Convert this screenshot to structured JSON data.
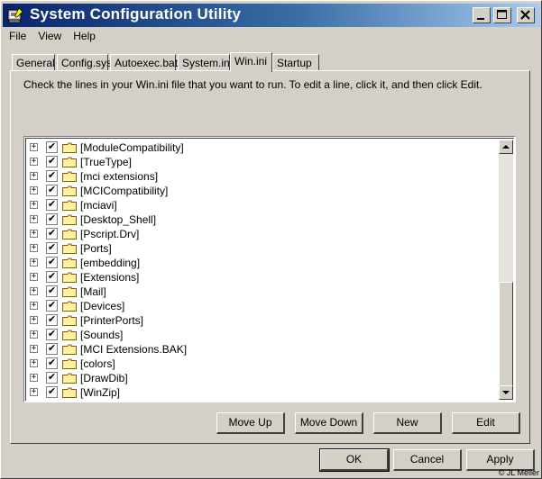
{
  "window": {
    "title": "System Configuration Utility",
    "title_gradient": [
      "#08246b",
      "#a6caf0"
    ]
  },
  "menu": [
    {
      "label": "File"
    },
    {
      "label": "View"
    },
    {
      "label": "Help"
    }
  ],
  "tabs": [
    {
      "label": "General"
    },
    {
      "label": "Config.sys"
    },
    {
      "label": "Autoexec.bat"
    },
    {
      "label": "System.ini"
    },
    {
      "label": "Win.ini",
      "active": true
    },
    {
      "label": "Startup"
    }
  ],
  "instructions": "Check the lines in your Win.ini file that you want to run. To edit a line, click it, and then click Edit.",
  "list": [
    {
      "label": "[ModuleCompatibility]",
      "checked": true
    },
    {
      "label": "[TrueType]",
      "checked": true
    },
    {
      "label": "[mci extensions]",
      "checked": true
    },
    {
      "label": "[MCICompatibility]",
      "checked": true
    },
    {
      "label": "[mciavi]",
      "checked": true
    },
    {
      "label": "[Desktop_Shell]",
      "checked": true
    },
    {
      "label": "[Pscript.Drv]",
      "checked": true
    },
    {
      "label": "[Ports]",
      "checked": true
    },
    {
      "label": "[embedding]",
      "checked": true
    },
    {
      "label": "[Extensions]",
      "checked": true
    },
    {
      "label": "[Mail]",
      "checked": true
    },
    {
      "label": "[Devices]",
      "checked": true
    },
    {
      "label": "[PrinterPorts]",
      "checked": true
    },
    {
      "label": "[Sounds]",
      "checked": true
    },
    {
      "label": "[MCI Extensions.BAK]",
      "checked": true
    },
    {
      "label": "[colors]",
      "checked": true
    },
    {
      "label": "[DrawDib]",
      "checked": true
    },
    {
      "label": "[WinZip]",
      "checked": true
    }
  ],
  "list_buttons": {
    "move_up": "Move Up",
    "move_down": "Move Down",
    "new": "New",
    "edit": "Edit"
  },
  "dialog_buttons": {
    "ok": "OK",
    "cancel": "Cancel",
    "apply": "Apply"
  },
  "copyright": "© JL Meller",
  "icons": {
    "expander": "plus-expander-icon",
    "checkbox": "checkmark-icon",
    "folder": "folder-icon"
  }
}
